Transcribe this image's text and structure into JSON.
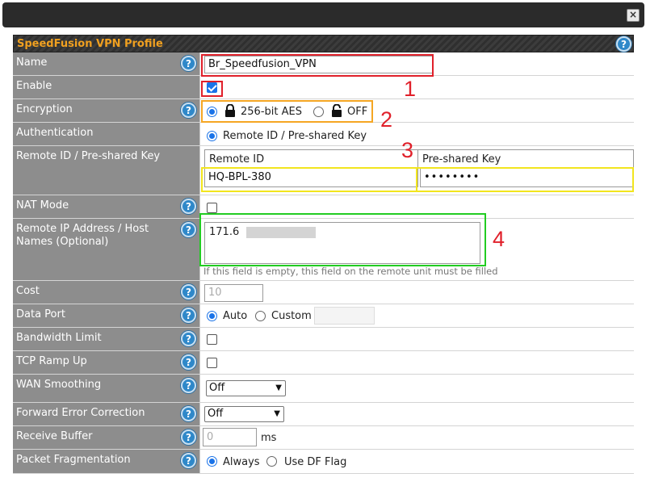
{
  "window": {
    "close_glyph": "×"
  },
  "panel": {
    "title": "SpeedFusion VPN Profile"
  },
  "rows": {
    "name": {
      "label": "Name",
      "value": "Br_Speedfusion_VPN"
    },
    "enable": {
      "label": "Enable",
      "checked": true
    },
    "encryption": {
      "label": "Encryption",
      "option_aes": "256-bit AES",
      "option_off": "OFF",
      "selected": "256-bit AES"
    },
    "authentication": {
      "label": "Authentication",
      "option": "Remote ID / Pre-shared Key"
    },
    "remote_id_psk": {
      "label": "Remote ID / Pre-shared Key",
      "col_remote_id": "Remote ID",
      "col_psk": "Pre-shared Key",
      "remote_id_value": "HQ-BPL-380",
      "psk_value": "••••••••"
    },
    "nat_mode": {
      "label": "NAT Mode",
      "checked": false
    },
    "remote_ip": {
      "label": "Remote IP Address / Host Names (Optional)",
      "value": "171.6",
      "hint": "If this field is empty, this field on the remote unit must be filled"
    },
    "cost": {
      "label": "Cost",
      "placeholder": "10"
    },
    "data_port": {
      "label": "Data Port",
      "option_auto": "Auto",
      "option_custom": "Custom",
      "selected": "Auto"
    },
    "bandwidth_limit": {
      "label": "Bandwidth Limit",
      "checked": false
    },
    "tcp_ramp_up": {
      "label": "TCP Ramp Up",
      "checked": false
    },
    "wan_smoothing": {
      "label": "WAN Smoothing",
      "value": "Off"
    },
    "fec": {
      "label": "Forward Error Correction",
      "value": "Off"
    },
    "receive_buffer": {
      "label": "Receive Buffer",
      "placeholder": "0",
      "unit": "ms"
    },
    "packet_fragmentation": {
      "label": "Packet Fragmentation",
      "option_always": "Always",
      "option_df": "Use DF Flag",
      "selected": "Always"
    }
  },
  "annotations": {
    "n1": "1",
    "n2": "2",
    "n3": "3",
    "n4": "4"
  },
  "colors": {
    "title": "#f0a020",
    "label_bg": "#8d8d8d",
    "accent": "#1a73e8",
    "help": "#2f88c9",
    "annotation_red": "#e0202a",
    "annotation_orange": "#f5a623",
    "annotation_yellow": "#f2e51e",
    "annotation_green": "#22cc22"
  },
  "icons": {
    "help": "help-icon",
    "lock_closed": "lock-closed-icon",
    "lock_open": "lock-open-icon",
    "close": "close-icon",
    "dropdown": "chevron-down-icon"
  },
  "help_glyph": "?",
  "chevron_glyph": "▼"
}
